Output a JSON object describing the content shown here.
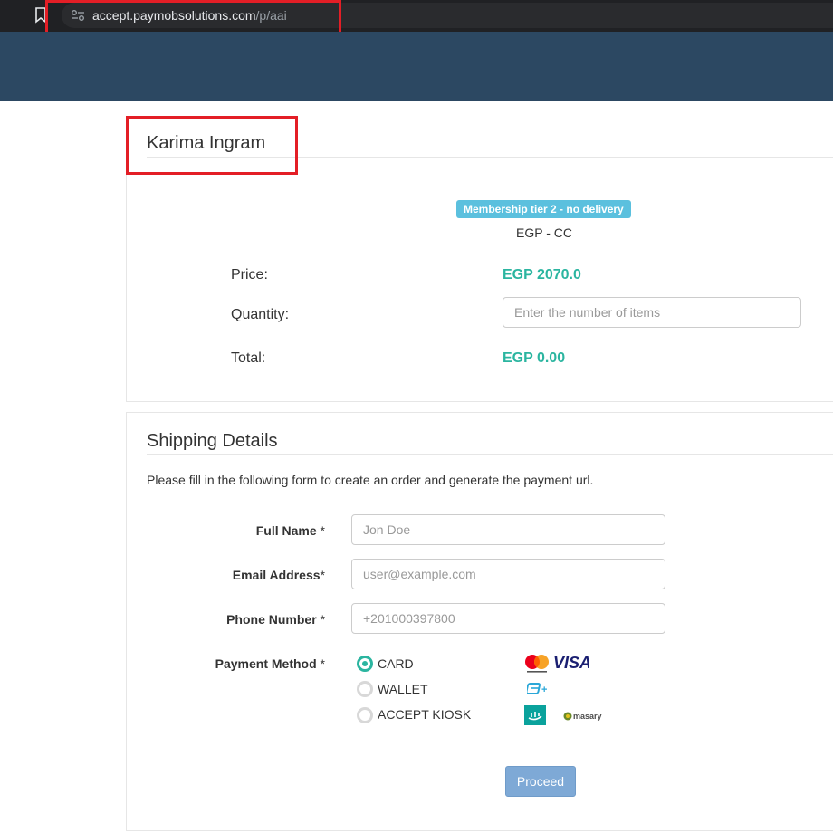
{
  "browser": {
    "url_domain": "accept.paymobsolutions.com",
    "url_path": "/p/aai"
  },
  "product_panel": {
    "title": "Karima Ingram",
    "badge": "Membership tier 2 - no delivery",
    "currency_label": "EGP - CC",
    "price_label": "Price:",
    "price_value": "EGP 2070.0",
    "quantity_label": "Quantity:",
    "quantity_placeholder": "Enter the number of items",
    "total_label": "Total:",
    "total_value": "EGP 0.00"
  },
  "shipping_panel": {
    "title": "Shipping Details",
    "intro": "Please fill in the following form to create an order and generate the payment url.",
    "full_name_label": "Full Name",
    "full_name_placeholder": "Jon Doe",
    "email_label": "Email Address",
    "email_placeholder": "user@example.com",
    "phone_label": "Phone Number",
    "phone_placeholder": "+201000397800",
    "payment_method_label": "Payment Method",
    "required_marker": "*",
    "payment_options": [
      {
        "label": "CARD",
        "checked": true
      },
      {
        "label": "WALLET",
        "checked": false
      },
      {
        "label": "ACCEPT KIOSK",
        "checked": false
      }
    ],
    "logos": {
      "visa": "VISA",
      "masary": "masary"
    },
    "proceed_label": "Proceed"
  },
  "colors": {
    "header": "#2c4862",
    "accent_teal": "#2bb5a0",
    "badge": "#5bc0de",
    "button": "#7ea9d6",
    "highlight": "#e31e26"
  },
  "icons": [
    "bookmark-icon",
    "site-info-icon",
    "mastercard-icon",
    "visa-icon",
    "wallet-icon",
    "aman-icon",
    "masary-icon"
  ]
}
